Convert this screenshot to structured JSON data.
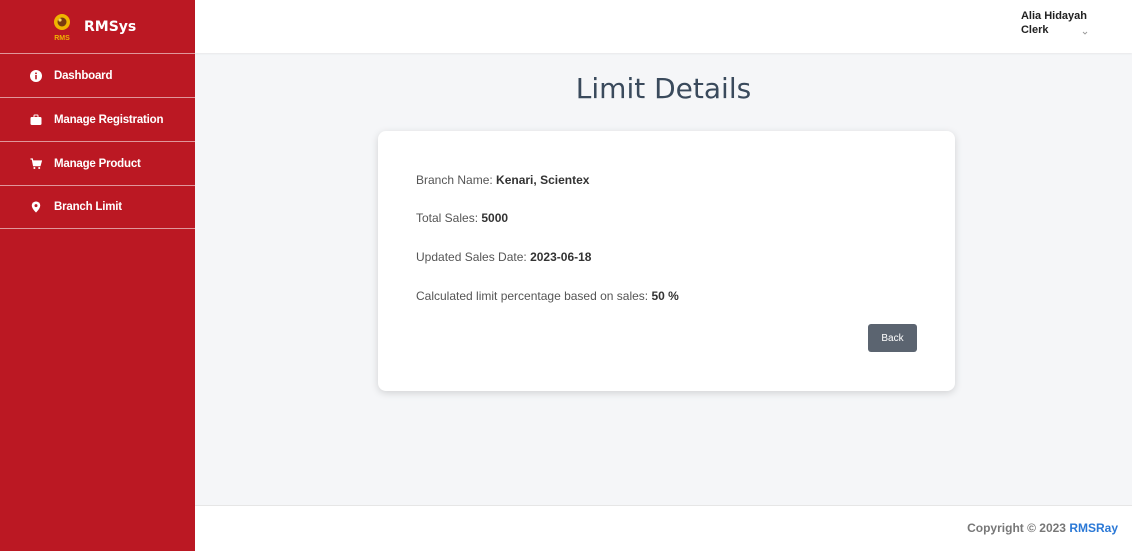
{
  "app": {
    "name": "RMSys",
    "logo_text": "RMS"
  },
  "sidebar": {
    "items": [
      {
        "label": "Dashboard",
        "icon": "info-icon"
      },
      {
        "label": "Manage Registration",
        "icon": "briefcase-icon"
      },
      {
        "label": "Manage Product",
        "icon": "cart-icon"
      },
      {
        "label": "Branch Limit",
        "icon": "map-pin-icon"
      }
    ]
  },
  "user": {
    "name": "Alia Hidayah",
    "role": "Clerk"
  },
  "page": {
    "title": "Limit Details"
  },
  "details": {
    "branch_label": "Branch Name: ",
    "branch_value": "Kenari, Scientex",
    "sales_label": "Total Sales: ",
    "sales_value": "5000",
    "date_label": "Updated Sales Date: ",
    "date_value": "2023-06-18",
    "percent_label": "Calculated limit percentage based on sales: ",
    "percent_value": "50 %",
    "back_label": "Back"
  },
  "footer": {
    "copyright": "Copyright © 2023 ",
    "brand": "RMSRay"
  },
  "colors": {
    "sidebar": "#bb1823",
    "button": "#5b6470",
    "link": "#2a78d6",
    "title": "#3a4a5c"
  }
}
